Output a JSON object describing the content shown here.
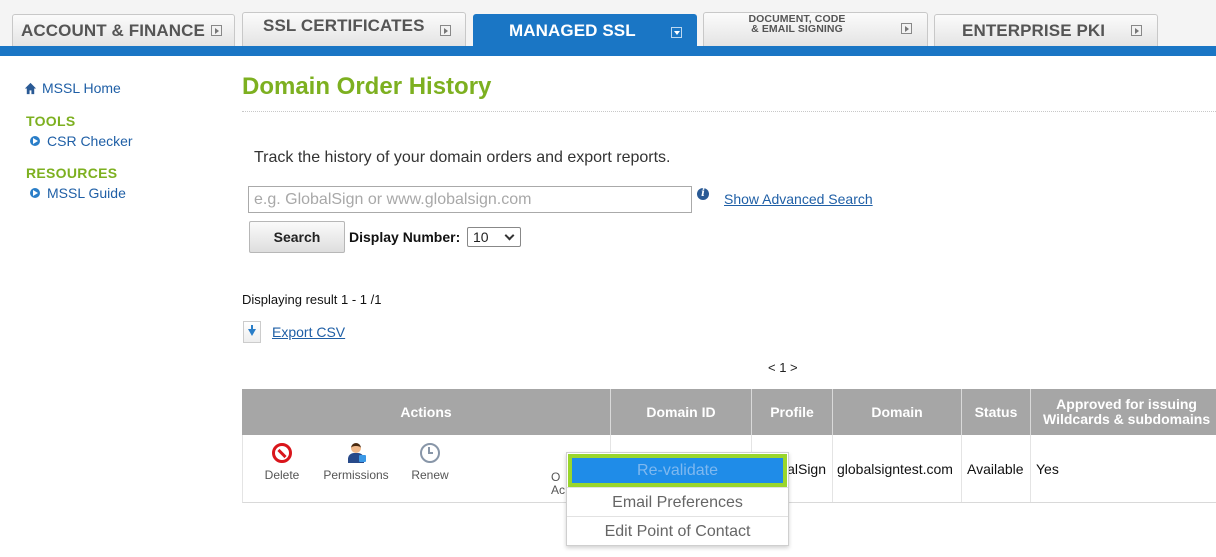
{
  "tabs": [
    {
      "label": "ACCOUNT & FINANCE"
    },
    {
      "label": "SSL CERTIFICATES"
    },
    {
      "label": "MANAGED SSL"
    },
    {
      "label": "DOCUMENT, CODE\n& EMAIL SIGNING"
    },
    {
      "label": "ENTERPRISE PKI"
    }
  ],
  "sidebar": {
    "home": "MSSL Home",
    "tools_heading": "TOOLS",
    "tools": [
      "CSR Checker"
    ],
    "resources_heading": "RESOURCES",
    "resources": [
      "MSSL Guide"
    ]
  },
  "main": {
    "title": "Domain Order History",
    "intro": "Track the history of your domain orders and export reports.",
    "search_placeholder": "e.g. GlobalSign or www.globalsign.com",
    "advanced_search": "Show Advanced Search",
    "search_button": "Search",
    "display_number_label": "Display Number:",
    "display_number_value": "10",
    "result_text": "Displaying result 1 - 1 /1",
    "export_csv": "Export CSV",
    "pager": "< 1 >"
  },
  "table": {
    "headers": [
      "Actions",
      "Domain ID",
      "Profile",
      "Domain",
      "Status",
      "Approved for issuing\nWildcards & subdomains"
    ],
    "row": {
      "actions": [
        "Delete",
        "Permissions",
        "Renew"
      ],
      "other_actions": "O\nAc",
      "domain_id": "",
      "profile": "alSign",
      "domain": "globalsigntest.com",
      "status": "Available",
      "approved": "Yes"
    }
  },
  "menu": {
    "items": [
      "Re-validate",
      "Email Preferences",
      "Edit Point of Contact"
    ]
  },
  "colors": {
    "brand_blue": "#1a76c5",
    "title_green": "#7db020",
    "highlight_outline": "#9ad62c"
  }
}
